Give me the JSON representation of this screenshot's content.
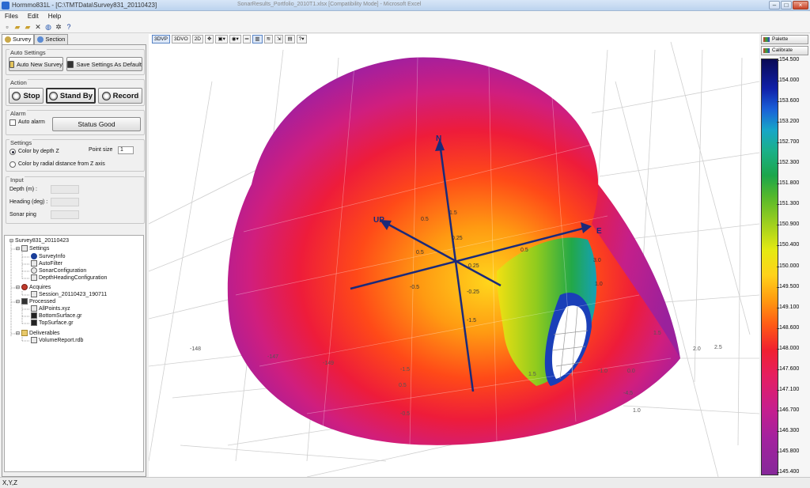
{
  "window": {
    "title": "Hormmo831L - [C:\\TMTData\\Survey831_20110423]",
    "background_title": "SonarResults_Portfolio_2010T1.xlsx [Compatibility Mode] - Microsoft Excel"
  },
  "menu": [
    "Files",
    "Edit",
    "Help"
  ],
  "tabs": {
    "survey": "Survey",
    "section": "Section"
  },
  "auto_settings": {
    "title": "Auto Settings",
    "new_survey": "Auto New Survey",
    "save_default": "Save Settings As Default"
  },
  "action": {
    "title": "Action",
    "stop": "Stop",
    "stand_by": "Stand By",
    "record": "Record"
  },
  "alarm": {
    "title": "Alarm",
    "auto_alarm": "Auto alarm",
    "status": "Status Good"
  },
  "settings": {
    "title": "Settings",
    "color_depth": "Color by depth Z",
    "color_radial": "Color by radial distance from Z axis",
    "point_size_label": "Point size",
    "point_size": "1"
  },
  "input": {
    "title": "Input",
    "depth": "Depth (m) :",
    "heading": "Heading (deg) :",
    "sonar": "Sonar ping"
  },
  "tree": {
    "root": "Survey831_20110423",
    "settings": "Settings",
    "survey_info": "SurveyInfo",
    "auto_filter": "AutoFilter",
    "sonar_config": "SonarConfiguration",
    "depth_heading": "DepthHeadingConfiguration",
    "acquires": "Acquires",
    "session": "Session_20110423_190711",
    "processed": "Processed",
    "all_points": "AllPoints.xyz",
    "bottom_surface": "BottomSurface.gr",
    "top_surface": "TopSurface.gr",
    "deliverables": "Deliverables",
    "volume_report": "VolumeReport.rdb"
  },
  "view_toolbar": [
    "3DVP",
    "3DVO",
    "2D"
  ],
  "axis_labels": {
    "north": "N",
    "east": "E",
    "up": "UP"
  },
  "axis_ticks": {
    "n1": "1.5",
    "n2": "0.25",
    "n3": "0.5",
    "e1": "0.25",
    "e2": "0.5",
    "e3": "1.0",
    "e4": "1.5",
    "e5": "2.0",
    "e6": "2.5",
    "e7": "3.0",
    "d1": "-0.25",
    "d2": "-0.5",
    "d3": "-1.5",
    "u1": "0.5"
  },
  "grid_labels": {
    "g1": "-148",
    "g2": "-147",
    "g3": "-149",
    "g4": "1.5",
    "g5": "0.5",
    "g6": "-0.5",
    "g7": "-1.0",
    "g8": "1.0",
    "g9": "1.5",
    "g10": "2.0",
    "g11": "2.5",
    "g12": "-4.5",
    "g13": "0.0",
    "g14": "-1.5"
  },
  "colorbar": {
    "palette_btn": "Palette",
    "calibrate_btn": "Calibrate",
    "ticks": [
      "154.500",
      "154.000",
      "153.600",
      "153.200",
      "152.700",
      "152.300",
      "151.800",
      "151.300",
      "150.900",
      "150.400",
      "150.000",
      "149.500",
      "149.100",
      "148.600",
      "148.000",
      "147.600",
      "147.100",
      "146.700",
      "146.300",
      "145.800",
      "145.400"
    ]
  },
  "status": "X,Y,Z"
}
